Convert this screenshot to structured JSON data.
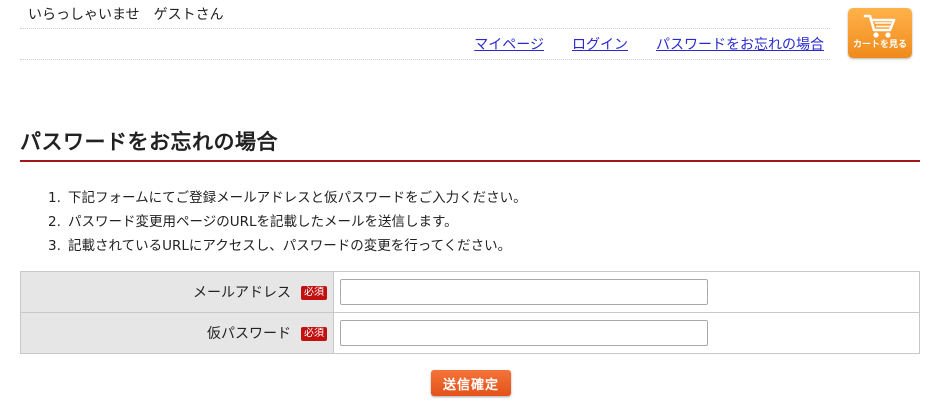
{
  "header": {
    "greeting": "いらっしゃいませ　ゲストさん",
    "nav": [
      "マイページ",
      "ログイン",
      "パスワードをお忘れの場合"
    ],
    "cart_label": "カートを見る"
  },
  "page": {
    "title": "パスワードをお忘れの場合",
    "steps": [
      {
        "num": "1.",
        "text": "下記フォームにてご登録メールアドレスと仮パスワードをご入力ください。"
      },
      {
        "num": "2.",
        "text": "パスワード変更用ページのURLを記載したメールを送信します。"
      },
      {
        "num": "3.",
        "text": "記載されているURLにアクセスし、パスワードの変更を行ってください。"
      }
    ]
  },
  "form": {
    "required_badge": "必須",
    "email_label": "メールアドレス",
    "email_value": "",
    "temp_password_label": "仮パスワード",
    "temp_password_value": "",
    "submit_label": "送信確定"
  },
  "colors": {
    "link": "#2a2ad0",
    "title_rule": "#a01818",
    "required_badge": "#c01010",
    "submit": "#e3521a",
    "cart_button": "#f08a1c"
  }
}
